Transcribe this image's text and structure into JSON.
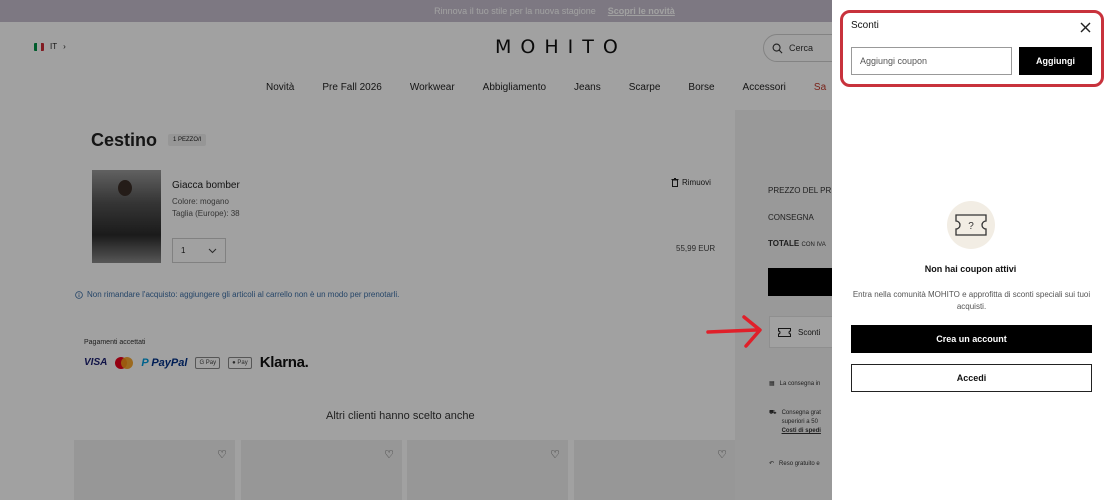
{
  "promo": {
    "text": "Rinnova il tuo stile per la nuova stagione",
    "link": "Scopri le novità"
  },
  "header": {
    "language": "IT",
    "logo": "MOHITO",
    "search_placeholder": "Cerca",
    "flag_colors": [
      "#009246",
      "#ffffff",
      "#ce2b37"
    ]
  },
  "nav": [
    "Novità",
    "Pre Fall 2026",
    "Workwear",
    "Abbigliamento",
    "Jeans",
    "Scarpe",
    "Borse",
    "Accessori",
    "Sa"
  ],
  "cart": {
    "title": "Cestino",
    "count": "1 PEZZO/I",
    "product": {
      "name": "Giacca bomber",
      "color": "Colore: mogano",
      "size": "Taglia (Europe): 38",
      "quantity": "1",
      "price": "55,99 EUR",
      "remove_label": "Rimuovi"
    },
    "notice": "Non rimandare l'acquisto: aggiungere gli articoli al carrello non è un modo per prenotarli."
  },
  "payments": {
    "label": "Pagamenti accettati",
    "methods": [
      "VISA",
      "Mastercard",
      "PayPal",
      "G Pay",
      "Pay",
      "Klarna."
    ]
  },
  "recommendations": {
    "title": "Altri clienti hanno scelto anche"
  },
  "summary": {
    "product_price_label": "PREZZO DEL PR",
    "delivery_label": "CONSEGNA",
    "total_label": "TOTALE",
    "total_vat": "CON IVA",
    "discounts_label": "Sconti",
    "info_1": "La consegna in",
    "info_2_line1": "Consegna grat",
    "info_2_line2": "superiori a 50",
    "info_2_link": "Costi di spedi",
    "info_3": "Reso gratuito e"
  },
  "drawer": {
    "title": "Sconti",
    "coupon_placeholder": "Aggiungi coupon",
    "add_button": "Aggiungi",
    "empty_title": "Non hai coupon attivi",
    "empty_desc": "Entra nella comunità MOHITO e approfitta di sconti speciali sui tuoi acquisti.",
    "create_account": "Crea un account",
    "login": "Accedi"
  },
  "colors": {
    "highlight": "#c8323c",
    "promo_bg": "#c7bfcf",
    "notice_text": "#3b6ea5",
    "sale_text": "#c0392b"
  }
}
